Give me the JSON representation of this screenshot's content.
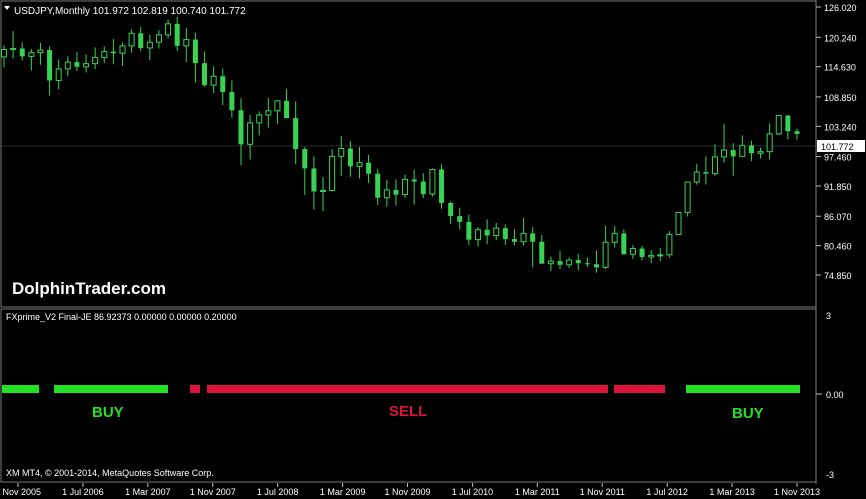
{
  "chart_title": "USDJPY,Monthly  101.972 102.819 100.740 101.772",
  "watermark": "DolphinTrader.com",
  "price_axis": {
    "labels": [
      "126.020",
      "120.240",
      "114.630",
      "108.850",
      "103.240",
      "97.460",
      "91.850",
      "86.070",
      "80.460",
      "74.850"
    ],
    "current_price_tag": "101.772"
  },
  "indicator": {
    "title": "FXprime_V2 Final-JE 86.92373 0.00000 0.00000 0.20000",
    "axis_labels": [
      "3",
      "0.00",
      "-3"
    ],
    "buy_label_1": "BUY",
    "sell_label": "SELL",
    "buy_label_2": "BUY"
  },
  "copyright": "XM MT4, © 2001-2014, MetaQuotes Software Corp.",
  "time_axis": [
    "1 Nov 2005",
    "1 Jul 2006",
    "1 Mar 2007",
    "1 Nov 2007",
    "1 Jul 2008",
    "1 Mar 2009",
    "1 Nov 2009",
    "1 Jul 2010",
    "1 Mar 2011",
    "1 Nov 2011",
    "1 Jul 2012",
    "1 Mar 2013",
    "1 Nov 2013"
  ],
  "colors": {
    "background": "#000000",
    "bull": "#39d353",
    "bear": "#39d353",
    "buy": "#22e022",
    "sell": "#dc143c",
    "axis": "#c0c0c0"
  },
  "chart_data": {
    "type": "candlestick",
    "ylim": [
      74.85,
      126.02
    ],
    "ohlc": [
      [
        116.5,
        118.7,
        114.5,
        117.9
      ],
      [
        117.9,
        121.4,
        116.2,
        118.1
      ],
      [
        118.1,
        119.3,
        115.8,
        116.6
      ],
      [
        116.6,
        118.0,
        113.9,
        117.3
      ],
      [
        117.3,
        119.2,
        115.0,
        117.8
      ],
      [
        117.8,
        118.5,
        109.1,
        112.0
      ],
      [
        112.0,
        116.0,
        110.3,
        114.2
      ],
      [
        114.2,
        116.6,
        112.8,
        115.5
      ],
      [
        115.5,
        117.4,
        113.8,
        114.6
      ],
      [
        114.6,
        117.0,
        113.5,
        115.2
      ],
      [
        115.2,
        118.3,
        114.2,
        116.4
      ],
      [
        116.4,
        118.5,
        115.3,
        117.5
      ],
      [
        117.5,
        119.9,
        115.1,
        117.2
      ],
      [
        117.2,
        119.2,
        114.8,
        118.6
      ],
      [
        118.6,
        121.8,
        117.3,
        121.0
      ],
      [
        121.0,
        122.2,
        117.6,
        118.2
      ],
      [
        118.2,
        120.7,
        115.9,
        119.3
      ],
      [
        119.3,
        121.6,
        118.1,
        120.7
      ],
      [
        120.7,
        123.6,
        120.0,
        122.8
      ],
      [
        122.8,
        124.1,
        117.6,
        118.6
      ],
      [
        118.6,
        122.0,
        115.5,
        119.8
      ],
      [
        119.8,
        121.1,
        111.6,
        115.3
      ],
      [
        115.3,
        117.5,
        110.8,
        111.1
      ],
      [
        111.1,
        114.7,
        109.6,
        112.8
      ],
      [
        112.8,
        114.3,
        107.3,
        109.8
      ],
      [
        109.8,
        112.0,
        104.9,
        106.3
      ],
      [
        106.3,
        108.6,
        95.8,
        99.8
      ],
      [
        99.8,
        105.4,
        96.9,
        103.9
      ],
      [
        103.9,
        106.1,
        101.5,
        105.4
      ],
      [
        105.4,
        108.6,
        103.0,
        106.2
      ],
      [
        106.2,
        108.2,
        103.7,
        108.1
      ],
      [
        108.1,
        110.4,
        104.9,
        104.8
      ],
      [
        104.8,
        108.0,
        96.0,
        98.9
      ],
      [
        98.9,
        99.3,
        90.1,
        95.2
      ],
      [
        95.2,
        97.5,
        87.3,
        90.8
      ],
      [
        90.8,
        93.6,
        87.0,
        91.0
      ],
      [
        91.0,
        98.9,
        90.8,
        97.5
      ],
      [
        97.5,
        101.4,
        93.8,
        99.0
      ],
      [
        99.0,
        100.4,
        93.6,
        95.6
      ],
      [
        95.6,
        99.3,
        93.3,
        96.3
      ],
      [
        96.3,
        97.8,
        92.4,
        94.2
      ],
      [
        94.2,
        95.1,
        88.2,
        89.6
      ],
      [
        89.6,
        93.0,
        87.9,
        91.1
      ],
      [
        91.1,
        93.1,
        88.1,
        90.2
      ],
      [
        90.2,
        94.0,
        89.6,
        93.1
      ],
      [
        93.1,
        95.0,
        88.3,
        92.7
      ],
      [
        92.7,
        94.3,
        89.5,
        90.3
      ],
      [
        90.3,
        95.2,
        89.8,
        95.0
      ],
      [
        95.0,
        96.0,
        87.5,
        88.6
      ],
      [
        88.6,
        88.9,
        84.6,
        86.1
      ],
      [
        86.1,
        87.7,
        83.5,
        85.0
      ],
      [
        85.0,
        86.4,
        80.6,
        81.6
      ],
      [
        81.6,
        84.0,
        80.3,
        83.5
      ],
      [
        83.5,
        85.5,
        80.7,
        82.4
      ],
      [
        82.4,
        84.8,
        81.5,
        83.8
      ],
      [
        83.8,
        84.5,
        80.6,
        81.7
      ],
      [
        81.7,
        83.6,
        80.5,
        81.2
      ],
      [
        81.2,
        85.7,
        80.5,
        82.8
      ],
      [
        82.8,
        84.0,
        76.3,
        81.2
      ],
      [
        81.2,
        82.5,
        77.1,
        77.0
      ],
      [
        77.0,
        78.4,
        75.6,
        77.5
      ],
      [
        77.5,
        79.4,
        76.0,
        76.8
      ],
      [
        76.8,
        78.2,
        76.2,
        77.7
      ],
      [
        77.7,
        78.9,
        75.8,
        77.1
      ],
      [
        77.1,
        78.2,
        76.4,
        76.9
      ],
      [
        76.9,
        79.5,
        75.3,
        76.3
      ],
      [
        76.3,
        84.2,
        76.0,
        81.1
      ],
      [
        81.1,
        84.2,
        80.1,
        82.8
      ],
      [
        82.8,
        83.5,
        78.9,
        78.8
      ],
      [
        78.8,
        80.6,
        77.9,
        79.9
      ],
      [
        79.9,
        80.4,
        77.6,
        78.3
      ],
      [
        78.3,
        79.6,
        77.1,
        78.6
      ],
      [
        78.6,
        80.0,
        77.5,
        78.7
      ],
      [
        78.7,
        83.2,
        78.2,
        82.6
      ],
      [
        82.6,
        86.5,
        82.5,
        86.8
      ],
      [
        86.8,
        92.3,
        86.0,
        92.6
      ],
      [
        92.6,
        96.1,
        92.1,
        94.5
      ],
      [
        94.5,
        97.5,
        92.1,
        94.2
      ],
      [
        94.2,
        99.8,
        93.8,
        97.4
      ],
      [
        97.4,
        103.7,
        96.3,
        98.7
      ],
      [
        98.7,
        100.0,
        93.8,
        97.5
      ],
      [
        97.5,
        101.5,
        97.8,
        99.6
      ],
      [
        99.6,
        100.5,
        96.6,
        98.1
      ],
      [
        98.1,
        99.2,
        97.1,
        98.4
      ],
      [
        98.4,
        103.8,
        96.9,
        101.8
      ],
      [
        101.8,
        105.4,
        101.6,
        105.3
      ],
      [
        105.3,
        105.4,
        100.8,
        102.3
      ],
      [
        102.3,
        102.8,
        100.7,
        101.8
      ]
    ]
  }
}
